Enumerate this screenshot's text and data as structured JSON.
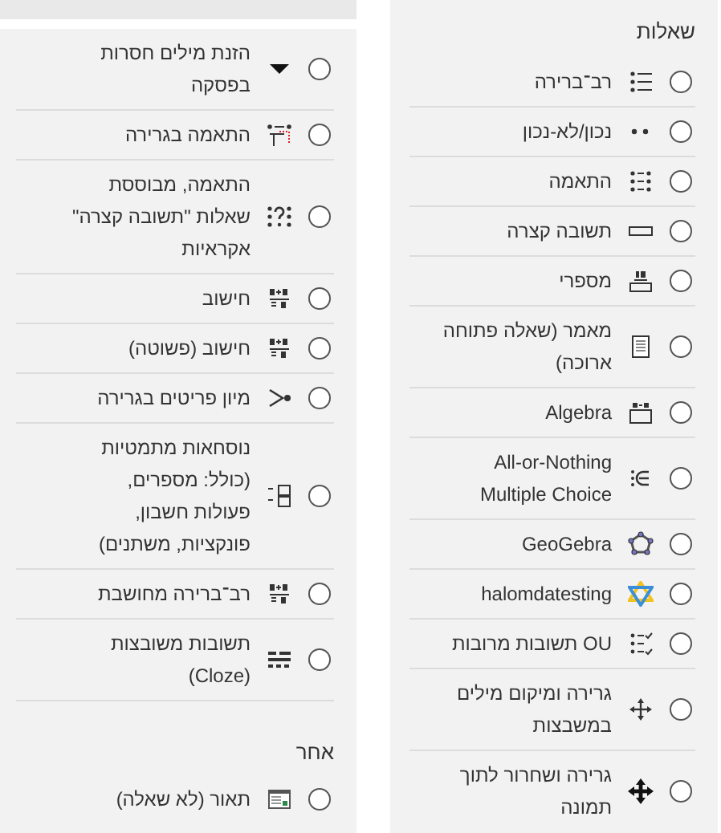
{
  "questions": {
    "heading": "שאלות",
    "items": [
      {
        "label": "רב־ברירה",
        "selected": false
      },
      {
        "label": "נכון/לא-נכון",
        "selected": false
      },
      {
        "label": "התאמה",
        "selected": false
      },
      {
        "label": "תשובה קצרה",
        "selected": false
      },
      {
        "label": "מספרי",
        "selected": false
      },
      {
        "label": "מאמר (שאלה פתוחה ארוכה)",
        "selected": false
      },
      {
        "label": "Algebra",
        "selected": false
      },
      {
        "label": "All-or-Nothing Multiple Choice",
        "selected": false
      },
      {
        "label": "GeoGebra",
        "selected": false
      },
      {
        "label": "halomdatesting",
        "selected": false
      },
      {
        "label": "OU תשובות מרובות",
        "selected": false
      },
      {
        "label": "גרירה ומיקום מילים במשבצות",
        "selected": false
      },
      {
        "label": "גרירה ושחרור לתוך תמונה",
        "selected": false
      },
      {
        "label": "הזנת מילים חסרות בפסקה",
        "selected": false
      },
      {
        "label": "התאמה בגרירה",
        "selected": false
      },
      {
        "label": "התאמה, מבוססת שאלות \"תשובה קצרה\" אקראיות",
        "selected": false
      },
      {
        "label": "חישוב",
        "selected": false
      },
      {
        "label": "חישוב (פשוטה)",
        "selected": false
      },
      {
        "label": "מיון פריטים בגרירה",
        "selected": false
      },
      {
        "label": "נוסחאות מתמטיות (כולל: מספרים, פעולות חשבון, פונקציות, משתנים)",
        "selected": false
      },
      {
        "label": "רב־ברירה מחושבת",
        "selected": false
      },
      {
        "label": "תשובות משובצות (Cloze)",
        "selected": false
      }
    ]
  },
  "other": {
    "heading": "אחר",
    "items": [
      {
        "label": "תאור (לא שאלה)",
        "selected": false
      }
    ]
  }
}
